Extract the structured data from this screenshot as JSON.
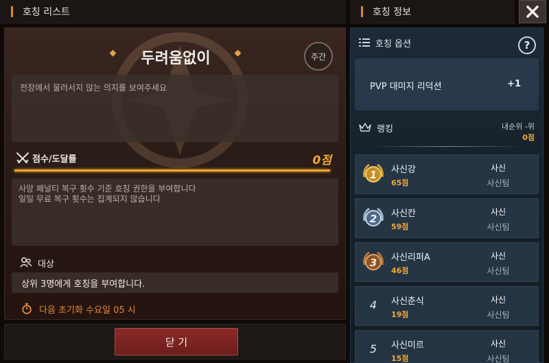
{
  "left_header": {
    "title": "호칭 리스트"
  },
  "right_header": {
    "title": "호칭 정보"
  },
  "title_detail": {
    "name": "두려움없이",
    "period_badge": "주간",
    "description": "전장에서 물러서지 않는 의지를 보여주세요",
    "score_label": "점수/도달률",
    "score_value": "0점",
    "score_progress": 1.0,
    "info_lines": [
      "사망 패널티 복구 횟수 기준 호칭 권한을 부여합니다",
      "일일 무료 복구 횟수는 집계되지 않습니다"
    ],
    "target_label": "대상",
    "target_text": "상위 3명에게 호칭을 부여합니다.",
    "reset_text": "다음 초기화 수요일 05 시"
  },
  "footer": {
    "close_label": "닫 기"
  },
  "info_panel": {
    "options_label": "호칭 옵션",
    "option": {
      "name": "PVP 대미지 리덕션",
      "value": "+1"
    },
    "ranking_label": "랭킹",
    "my_rank": "내순위 -위",
    "my_score": "0점",
    "rankings": [
      {
        "rank": "1",
        "name": "사신강",
        "score": "65점",
        "guild": "사신",
        "team": "사신팀",
        "medal": "gold"
      },
      {
        "rank": "2",
        "name": "사신칸",
        "score": "59점",
        "guild": "사신",
        "team": "사신팀",
        "medal": "silver"
      },
      {
        "rank": "3",
        "name": "사신리퍼A",
        "score": "46점",
        "guild": "사신",
        "team": "사신팀",
        "medal": "bronze"
      },
      {
        "rank": "4",
        "name": "사신춘식",
        "score": "19점",
        "guild": "사신",
        "team": "사신팀",
        "medal": "none"
      },
      {
        "rank": "5",
        "name": "사신미르",
        "score": "15점",
        "guild": "사신",
        "team": "사신팀",
        "medal": "none"
      }
    ]
  },
  "colors": {
    "accent": "#f0a42a",
    "reset": "#e58a3a",
    "close": "#8b2a28"
  }
}
